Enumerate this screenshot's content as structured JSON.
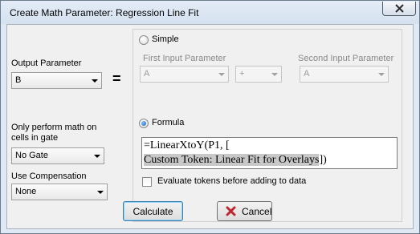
{
  "window": {
    "title": "Create Math Parameter: Regression Line Fit"
  },
  "output": {
    "label": "Output Parameter",
    "value": "B",
    "equals": "="
  },
  "gate": {
    "label_line1": "Only perform math on",
    "label_line2": "cells in gate",
    "value": "No Gate"
  },
  "compensation": {
    "label": "Use Compensation",
    "value": "None"
  },
  "simple": {
    "label": "Simple",
    "first_label": "First Input Parameter",
    "first_value": "A",
    "operator_value": "+",
    "second_label": "Second Input Parameter",
    "second_value": "A"
  },
  "formula": {
    "label": "Formula",
    "line1": "=LinearXtoY(P1, [",
    "line2_selected": "Custom Token: Linear Fit for Overlays",
    "line2_rest": "])"
  },
  "evaluate": {
    "label": "Evaluate tokens before adding to data"
  },
  "buttons": {
    "calculate": "Calculate",
    "cancel": "Cancel"
  },
  "colors": {
    "accent": "#1a5fb4",
    "cancel_x": "#c0262d"
  }
}
